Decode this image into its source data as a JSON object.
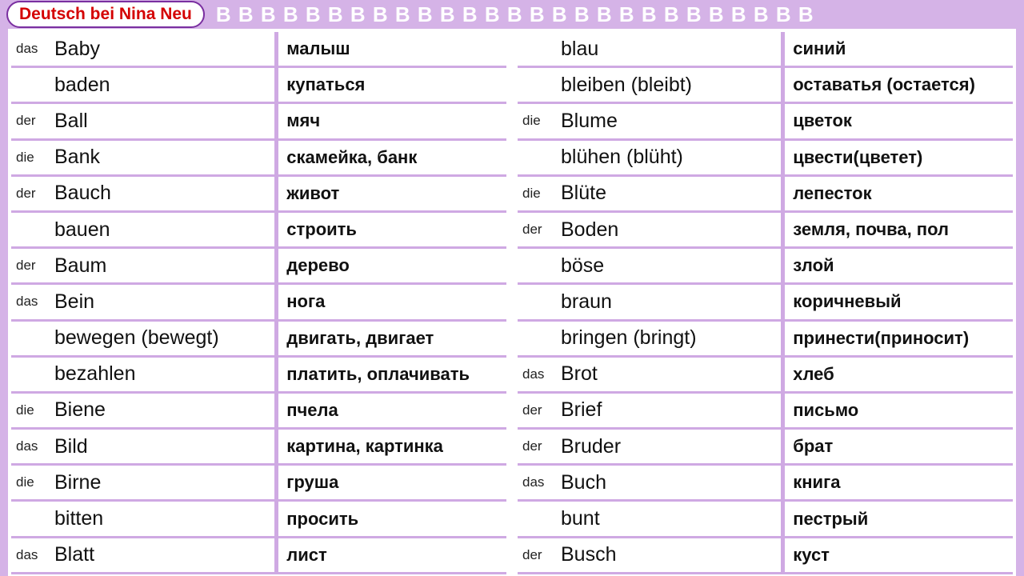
{
  "title": "Deutsch bei Nina Neu",
  "letter_run": "B B B B  B B B B  B B B B  B B B B  B B B B  B B B B  B B B",
  "left": [
    {
      "art": "das",
      "de": "Baby",
      "ru": "малыш"
    },
    {
      "art": "",
      "de": "baden",
      "ru": "купаться"
    },
    {
      "art": "der",
      "de": "Ball",
      "ru": "мяч"
    },
    {
      "art": "die",
      "de": "Bank",
      "ru": "скамейка, банк"
    },
    {
      "art": "der",
      "de": "Bauch",
      "ru": "живот"
    },
    {
      "art": "",
      "de": "bauen",
      "ru": "строить"
    },
    {
      "art": "der",
      "de": "Baum",
      "ru": "дерево"
    },
    {
      "art": "das",
      "de": "Bein",
      "ru": "нога"
    },
    {
      "art": "",
      "de": "bewegen (bewegt)",
      "ru": "двигать, двигает"
    },
    {
      "art": "",
      "de": "bezahlen",
      "ru": "платить, оплачивать"
    },
    {
      "art": "die",
      "de": "Biene",
      "ru": "пчела"
    },
    {
      "art": "das",
      "de": "Bild",
      "ru": "картина, картинка"
    },
    {
      "art": "die",
      "de": "Birne",
      "ru": "груша"
    },
    {
      "art": "",
      "de": "bitten",
      "ru": "просить"
    },
    {
      "art": "das",
      "de": "Blatt",
      "ru": "лист"
    }
  ],
  "right": [
    {
      "art": "",
      "de": "blau",
      "ru": "синий"
    },
    {
      "art": "",
      "de": "bleiben (bleibt)",
      "ru": "оставатья (остается)"
    },
    {
      "art": "die",
      "de": "Blume",
      "ru": "цветок"
    },
    {
      "art": "",
      "de": "blühen (blüht)",
      "ru": "цвести(цветет)"
    },
    {
      "art": "die",
      "de": "Blüte",
      "ru": "лепесток"
    },
    {
      "art": "der",
      "de": "Boden",
      "ru": "земля, почва, пол"
    },
    {
      "art": "",
      "de": "böse",
      "ru": "злой"
    },
    {
      "art": "",
      "de": "braun",
      "ru": "коричневый"
    },
    {
      "art": "",
      "de": "bringen (bringt)",
      "ru": "принести(приносит)"
    },
    {
      "art": "das",
      "de": "Brot",
      "ru": "хлеб"
    },
    {
      "art": "der",
      "de": "Brief",
      "ru": "письмо"
    },
    {
      "art": "der",
      "de": "Bruder",
      "ru": "брат"
    },
    {
      "art": "das",
      "de": "Buch",
      "ru": "книга"
    },
    {
      "art": "",
      "de": "bunt",
      "ru": "пестрый"
    },
    {
      "art": "der",
      "de": "Busch",
      "ru": "куст"
    }
  ]
}
